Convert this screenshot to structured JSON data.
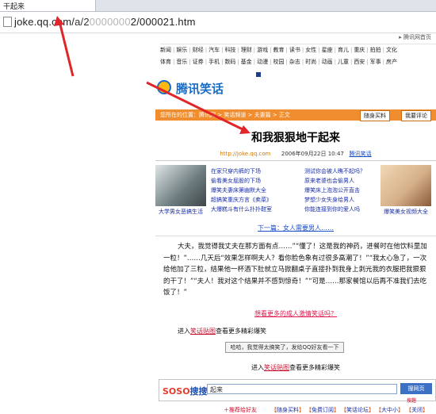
{
  "tab": {
    "title": "干起来"
  },
  "address": {
    "host": "joke.qq.com/",
    "path_a": "a/2",
    "path_blur": "0000000",
    "path_end": "2/000021.htm"
  },
  "top_link": "▸ 腾讯网首页",
  "nav": {
    "row1": [
      "新闻",
      "娱乐",
      "财经",
      "汽车",
      "科技",
      "理财",
      "游戏",
      "教育",
      "读书",
      "女性",
      "星座",
      "育儿",
      "重庆",
      "拍拍",
      "文化"
    ],
    "row2": [
      "体育",
      "音乐",
      "证券",
      "手机",
      "数码",
      "基金",
      "动漫",
      "校园",
      "杂志",
      "时尚",
      "动画",
      "儿童",
      "西安",
      "军事",
      "房产"
    ]
  },
  "logo": {
    "text": "腾讯笑话"
  },
  "breadcrumb": {
    "text": "您所在的位置：腾讯网 > 笑话频道 > 夫妻篇 > 正文",
    "btn_buy": "随身买料",
    "btn_comment": "我要评论"
  },
  "article": {
    "title": "和我狠狠地干起来",
    "site": "http://joke.qq.com",
    "date": "2006年09月22日 10:47",
    "source": "腾讯笑话",
    "next": "下一篇：女人需要男人……",
    "body": "大夫，我觉得我丈夫在那方面有点……”“懂了！这是我的神药，进餐时在他饮料里加一粒！”……几天后“效果怎样啊夫人？看你脸色象有过很多高潮了！”“我太心急了，一次给他加了三粒，结果他一杯酒下肚就立马掀翻桌子直接扑到我身上剥光我的衣服把我狠狠的干了！”“夫人！我对这个结果并不感到惊奇！”“可是……那家餐馆以后再不准我们去吃饭了！”",
    "promo": "想看更多的成人激情笑话吗？"
  },
  "thumbs": [
    {
      "caption": "大学男女恶搞生活",
      "color": "#6a7a7c"
    },
    {
      "caption": "爆笑美女视频大全",
      "color": "#d6b18a"
    }
  ],
  "links_left": [
    "在家只穿内裤的下场",
    "偷看美女屁股的下场",
    "爆笑夫妻床第幽默大全",
    "超搞笑重庆方言《卖菜》",
    "大爆糕斗有什么扑扑鞋室"
  ],
  "links_right": [
    "测试你会被人瞧不起吗？",
    "原来老婆也会偷男人",
    "爆笑床上泡泡公开直击",
    "梦想少女失身给男人",
    "你能连接到你的爱人吗"
  ],
  "more_jokes": {
    "prefix": "进入",
    "link": "笑话贴图",
    "suffix": "查看更多精彩爆笑"
  },
  "share": {
    "text": "哈哈，我觉得太搞笑了，发给QQ好友看一下"
  },
  "more_jokes2": {
    "prefix": "进入",
    "link": "笑话贴图",
    "suffix": "查看更多精彩爆笑"
  },
  "search": {
    "logo_a": "SOSO",
    "logo_b": "搜搜",
    "query": "起来",
    "button": "搜网页",
    "help": "搜趣"
  },
  "footer": {
    "fav": "＋推荐给好友",
    "items": [
      "随身买料",
      "免费订阅",
      "笑话论坛",
      "大中小",
      "关闭"
    ]
  }
}
